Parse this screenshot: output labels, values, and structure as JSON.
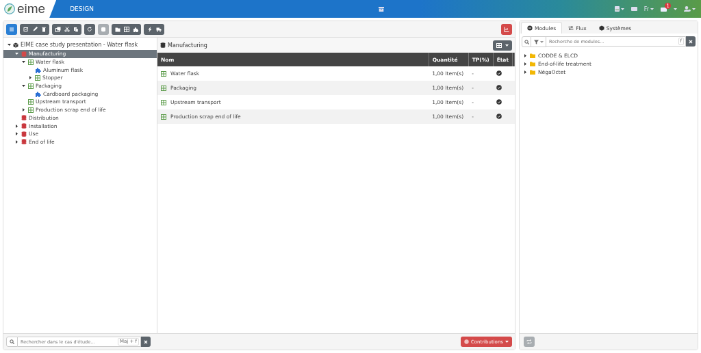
{
  "header": {
    "logo": "eime",
    "section": "DESIGN",
    "language": "Fr",
    "notification_count": "1"
  },
  "toolbar": {
    "groups": [
      [
        {
          "disabled": false,
          "kind": "primary"
        }
      ],
      [
        {
          "disabled": false,
          "kind": "default"
        },
        {
          "disabled": false,
          "kind": "default"
        },
        {
          "disabled": false,
          "kind": "default"
        }
      ],
      [
        {
          "disabled": false,
          "kind": "default"
        },
        {
          "disabled": false,
          "kind": "default"
        },
        {
          "disabled": false,
          "kind": "default"
        }
      ],
      [
        {
          "disabled": false,
          "kind": "default"
        }
      ],
      [
        {
          "disabled": true,
          "kind": "default"
        }
      ],
      [
        {
          "disabled": false,
          "kind": "default"
        },
        {
          "disabled": false,
          "kind": "default"
        },
        {
          "disabled": false,
          "kind": "default"
        }
      ],
      [
        {
          "disabled": false,
          "kind": "default"
        },
        {
          "disabled": false,
          "kind": "default"
        }
      ]
    ]
  },
  "tree": {
    "title": "EIME case study presentation - Water flask",
    "expanded": true,
    "children": [
      {
        "label": "Manufacturing",
        "kind": "phase",
        "expanded": true,
        "selected": true,
        "children": [
          {
            "label": "Water flask",
            "kind": "product",
            "expanded": true,
            "selected": false,
            "children": [
              {
                "label": "Aluminum flask",
                "kind": "module",
                "selected": false
              },
              {
                "label": "Stopper",
                "kind": "product",
                "expanded": false,
                "selected": false
              }
            ]
          },
          {
            "label": "Packaging",
            "kind": "product",
            "expanded": true,
            "selected": false,
            "children": [
              {
                "label": "Cardboard packaging",
                "kind": "module",
                "selected": false
              }
            ]
          },
          {
            "label": "Upstream transport",
            "kind": "product",
            "selected": false
          },
          {
            "label": "Production scrap end of life",
            "kind": "product",
            "expanded": false,
            "selected": false
          }
        ]
      },
      {
        "label": "Distribution",
        "kind": "phase",
        "selected": false
      },
      {
        "label": "Installation",
        "kind": "phase",
        "expanded": false,
        "selected": false
      },
      {
        "label": "Use",
        "kind": "phase",
        "expanded": false,
        "selected": false
      },
      {
        "label": "End of life",
        "kind": "phase",
        "expanded": false,
        "selected": false
      }
    ]
  },
  "content": {
    "breadcrumb": "Manufacturing",
    "columns": [
      "Nom",
      "Quantité",
      "TP(%)",
      "État"
    ],
    "rows": [
      {
        "name": "Water flask",
        "quantity": "1,00 Item(s)",
        "tp": "-",
        "done": true
      },
      {
        "name": "Packaging",
        "quantity": "1,00 Item(s)",
        "tp": "-",
        "done": true
      },
      {
        "name": "Upstream transport",
        "quantity": "1,00 Item(s)",
        "tp": "-",
        "done": true
      },
      {
        "name": "Production scrap end of life",
        "quantity": "1,00 Item(s)",
        "tp": "-",
        "done": true
      }
    ]
  },
  "bottom": {
    "search_placeholder": "Rechercher dans le cas d'étude...",
    "shortcut": "Maj + f",
    "contributions": "Contributions"
  },
  "side": {
    "tabs": [
      {
        "label": "Modules",
        "selected": true
      },
      {
        "label": "Flux",
        "selected": false
      },
      {
        "label": "Systèmes",
        "selected": false
      }
    ],
    "search_placeholder": "Recherche de modules...",
    "shortcut": "f",
    "folders": [
      {
        "label": "CODDE & ELCD",
        "expanded": false
      },
      {
        "label": "End-of-life treatment",
        "expanded": false
      },
      {
        "label": "NégaOctet",
        "expanded": false
      }
    ]
  }
}
